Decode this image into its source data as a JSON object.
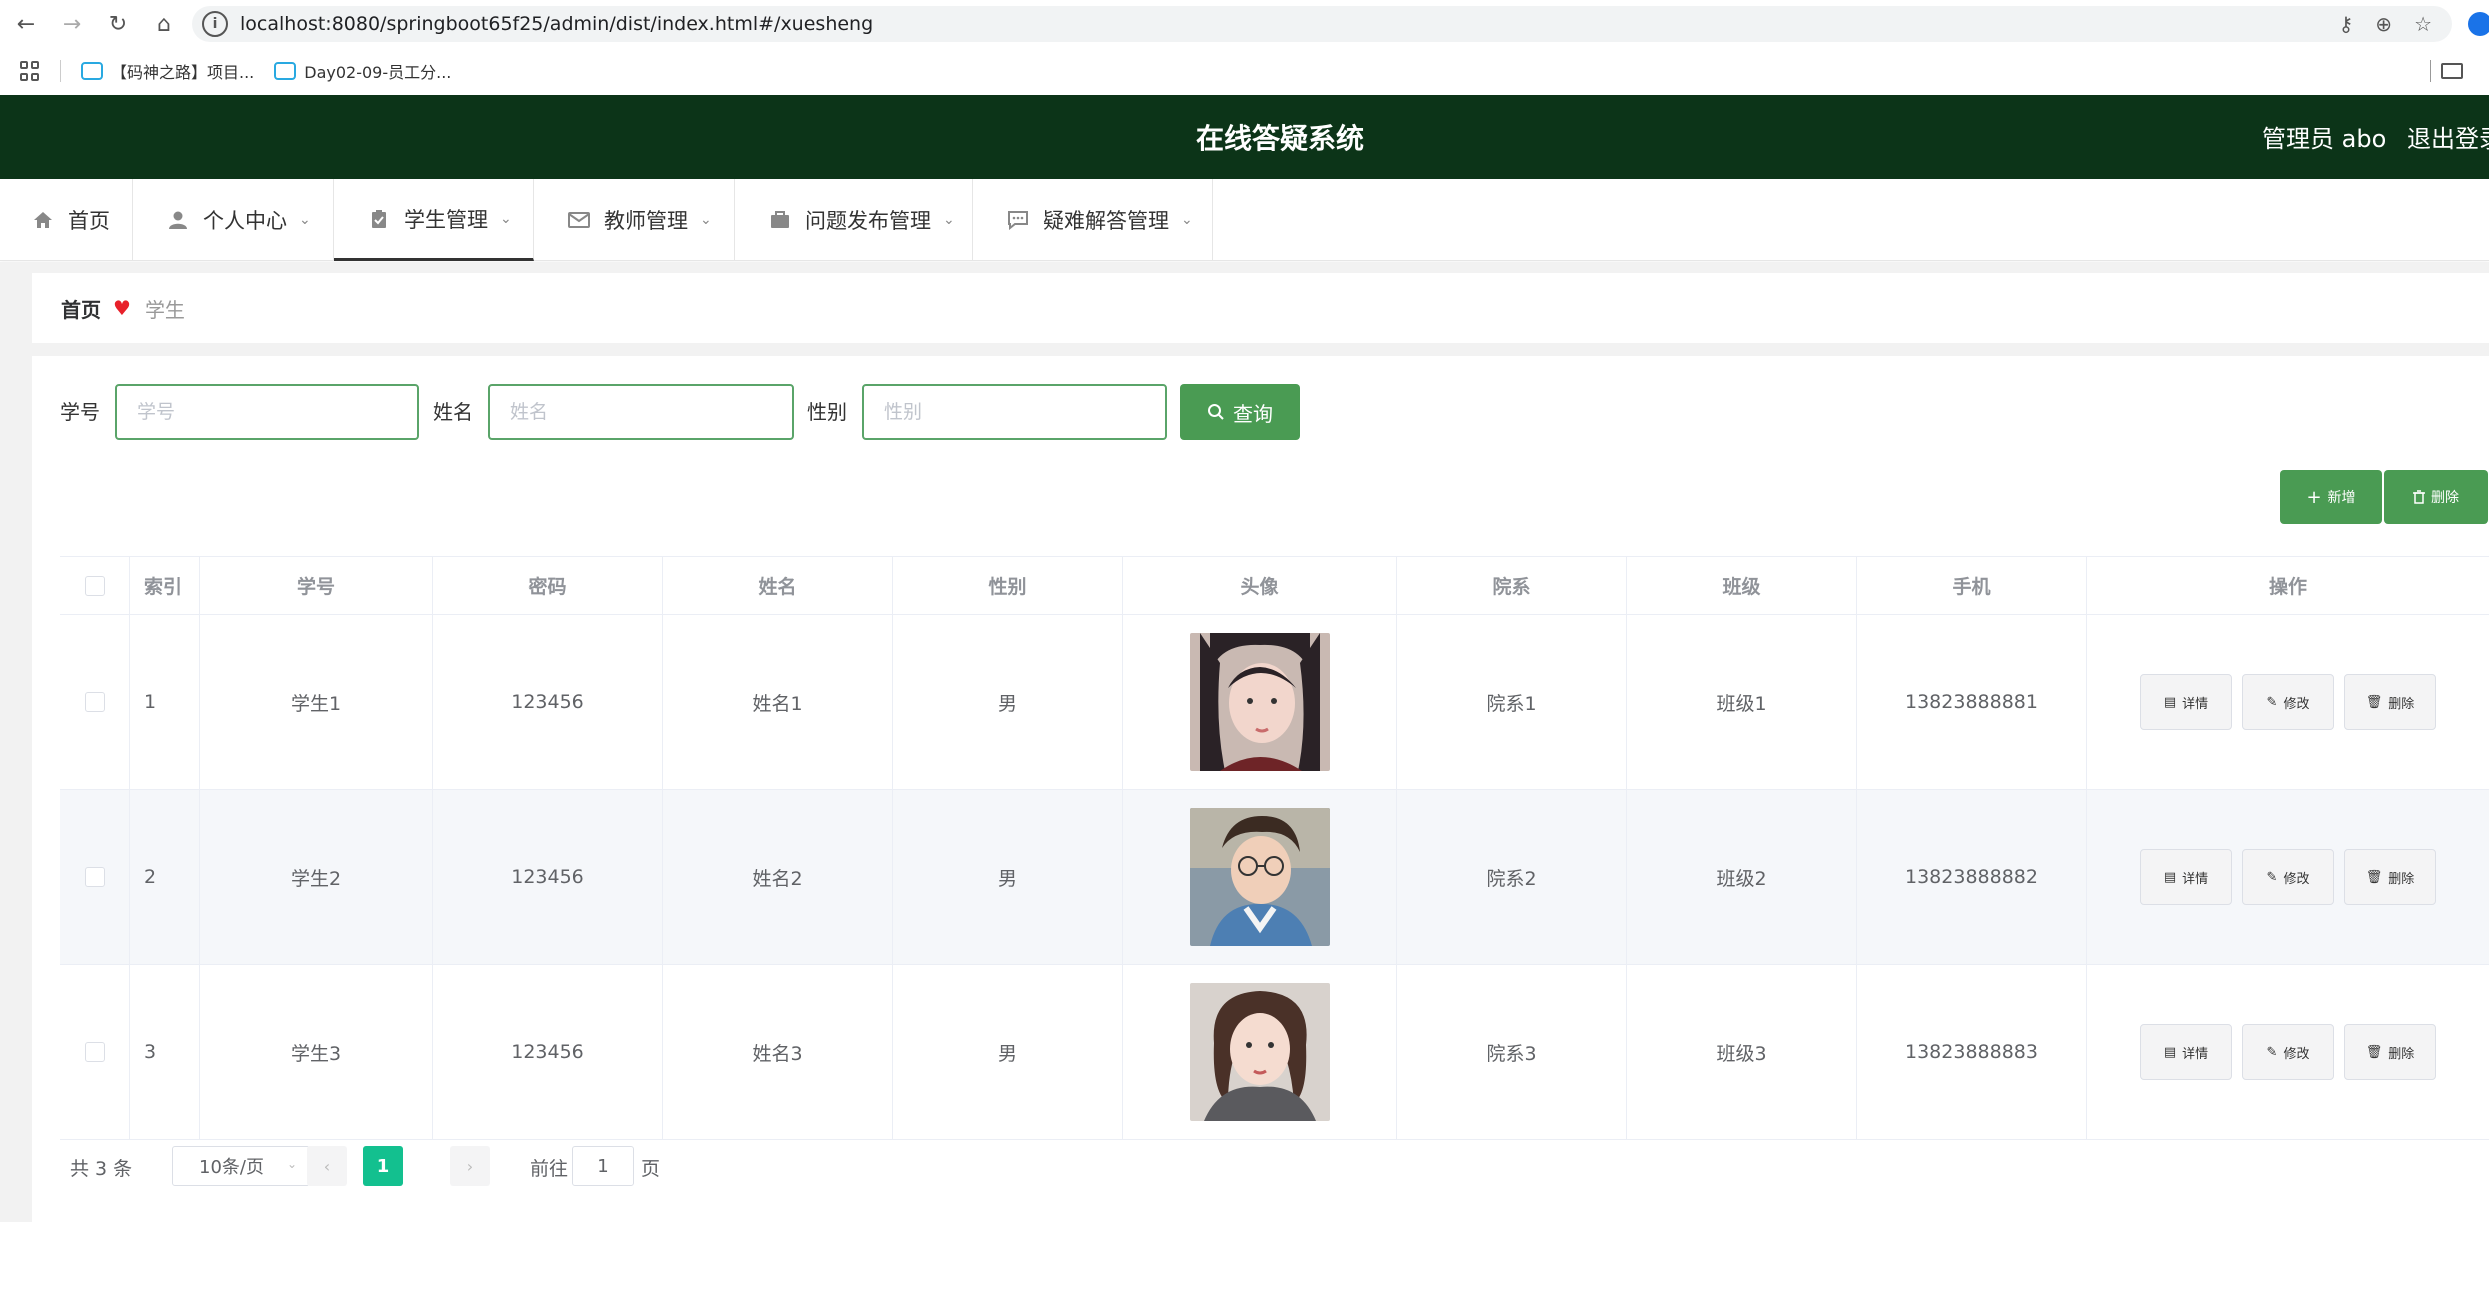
{
  "browser": {
    "url": "localhost:8080/springboot65f25/admin/dist/index.html#/xuesheng",
    "bookmarks": [
      "【码神之路】项目...",
      "Day02-09-员工分..."
    ]
  },
  "header": {
    "title": "在线答疑系统",
    "admin": "管理员 abo",
    "logout": "退出登录"
  },
  "menu": {
    "items": [
      {
        "label": "首页",
        "icon": "home-icon"
      },
      {
        "label": "个人中心",
        "icon": "user-icon"
      },
      {
        "label": "学生管理",
        "icon": "clipboard-icon"
      },
      {
        "label": "教师管理",
        "icon": "mail-icon"
      },
      {
        "label": "问题发布管理",
        "icon": "briefcase-icon"
      },
      {
        "label": "疑难解答管理",
        "icon": "chat-icon"
      }
    ]
  },
  "breadcrumb": {
    "home": "首页",
    "current": "学生"
  },
  "search": {
    "fields": [
      {
        "label": "学号",
        "placeholder": "学号"
      },
      {
        "label": "姓名",
        "placeholder": "姓名"
      },
      {
        "label": "性别",
        "placeholder": "性别"
      }
    ],
    "button": "查询"
  },
  "actions": {
    "add": "新增",
    "delete": "删除"
  },
  "table": {
    "columns": [
      "索引",
      "学号",
      "密码",
      "姓名",
      "性别",
      "头像",
      "院系",
      "班级",
      "手机",
      "操作"
    ],
    "rows": [
      {
        "index": "1",
        "xuehao": "学生1",
        "mima": "123456",
        "xingming": "姓名1",
        "xingbie": "男",
        "yuanxi": "院系1",
        "banji": "班级1",
        "shouji": "13823888881"
      },
      {
        "index": "2",
        "xuehao": "学生2",
        "mima": "123456",
        "xingming": "姓名2",
        "xingbie": "男",
        "yuanxi": "院系2",
        "banji": "班级2",
        "shouji": "13823888882"
      },
      {
        "index": "3",
        "xuehao": "学生3",
        "mima": "123456",
        "xingming": "姓名3",
        "xingbie": "男",
        "yuanxi": "院系3",
        "banji": "班级3",
        "shouji": "13823888883"
      }
    ],
    "row_actions": {
      "detail": "详情",
      "edit": "修改",
      "delete": "删除"
    }
  },
  "pagination": {
    "total": "共 3 条",
    "page_size": "10条/页",
    "current_page": "1",
    "goto_label": "前往",
    "goto_value": "1",
    "page_suffix": "页"
  },
  "colors": {
    "header_bg": "#0c3418",
    "primary": "#4a9b53",
    "pager_active": "#13c08f",
    "heart": "#e8202a"
  }
}
